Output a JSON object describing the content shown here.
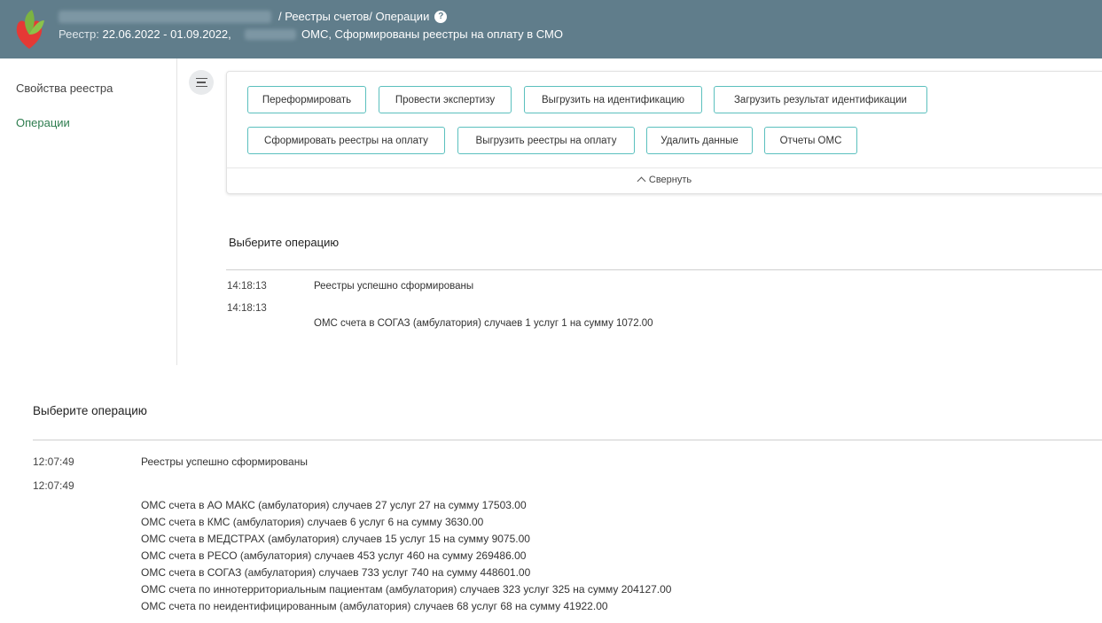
{
  "header": {
    "breadcrumb": "/ Реестры счетов/ Операции",
    "help_icon": "question-circle-icon",
    "registry_prefix": "Реестр:",
    "registry_dates": "22.06.2022 - 01.09.2022,",
    "registry_status": "ОМС, Сформированы реестры на оплату в СМО"
  },
  "sidebar": {
    "items": [
      {
        "label": "Свойства реестра"
      },
      {
        "label": "Операции"
      }
    ]
  },
  "toolbar": {
    "buttons": [
      "Переформировать",
      "Провести экспертизу",
      "Выгрузить на идентификацию",
      "Загрузить результат идентификации",
      "Сформировать реестры на оплату",
      "Выгрузить реестры на оплату",
      "Удалить данные",
      "Отчеты ОМС"
    ],
    "collapse_label": "Свернуть"
  },
  "top_log": {
    "title": "Выберите операцию",
    "entries": [
      {
        "time": "14:18:13",
        "text": "Реестры успешно сформированы"
      },
      {
        "time": "14:18:13",
        "text": "ОМС счета в СОГАЗ (амбулатория) случаев 1 услуг 1 на сумму 1072.00"
      }
    ]
  },
  "bottom_log": {
    "title": "Выберите операцию",
    "entries": [
      {
        "time": "12:07:49",
        "text": "Реестры успешно сформированы"
      },
      {
        "time": "12:07:49",
        "text": ""
      }
    ],
    "lines": [
      "ОМС счета в АО МАКС (амбулатория) случаев 27 услуг 27 на сумму 17503.00",
      "ОМС счета в КМС (амбулатория) случаев 6 услуг 6 на сумму 3630.00",
      "ОМС счета в МЕДСТРАХ (амбулатория) случаев 15 услуг 15 на сумму 9075.00",
      "ОМС счета в РЕСО (амбулатория) случаев 453 услуг 460 на сумму 269486.00",
      "ОМС счета в СОГАЗ (амбулатория) случаев 733 услуг 740 на сумму 448601.00",
      "ОМС счета по иннотерриториальным пациентам (амбулатория) случаев 323 услуг 325 на сумму 204127.00",
      "ОМС счета по неидентифицированным (амбулатория) случаев 68 услуг 68 на сумму 41922.00"
    ]
  },
  "colors": {
    "header_bg": "#607d8b",
    "accent": "#5bc0be",
    "active_link": "#2e7d4f"
  }
}
